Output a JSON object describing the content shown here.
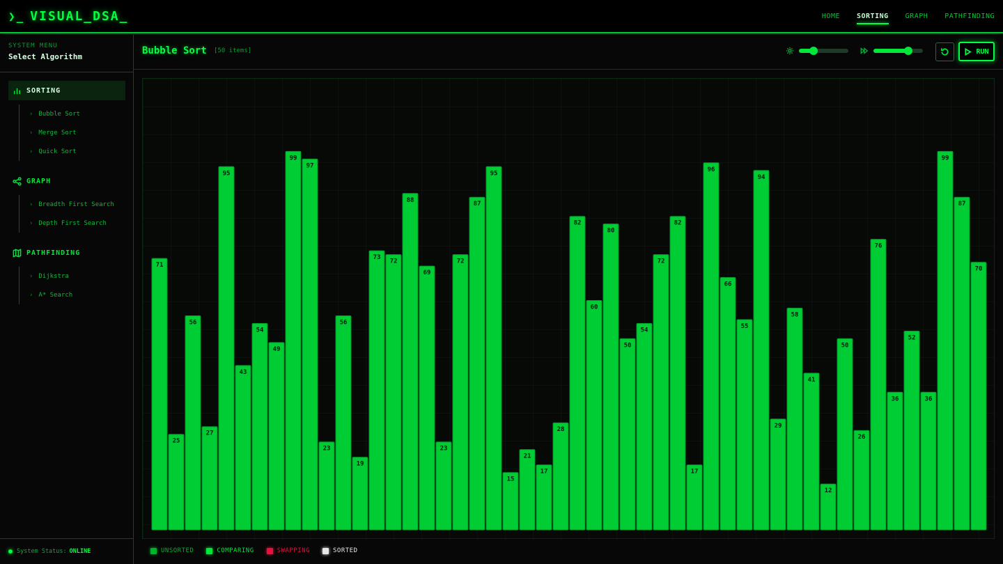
{
  "app": {
    "logo_icon": "terminal-prompt-icon",
    "prompt_glyph": "❯_",
    "title": "VISUAL_DSA_"
  },
  "nav": {
    "items": [
      {
        "label": "HOME",
        "active": false
      },
      {
        "label": "SORTING",
        "active": true
      },
      {
        "label": "GRAPH",
        "active": false
      },
      {
        "label": "PATHFINDING",
        "active": false
      }
    ]
  },
  "sidebar": {
    "subtitle": "SYSTEM MENU",
    "title": "Select Algorithm",
    "groups": [
      {
        "label": "SORTING",
        "icon": "bar-chart-icon",
        "active": true,
        "items": [
          "Bubble Sort",
          "Merge Sort",
          "Quick Sort"
        ]
      },
      {
        "label": "GRAPH",
        "icon": "share-nodes-icon",
        "active": false,
        "items": [
          "Breadth First Search",
          "Depth First Search"
        ]
      },
      {
        "label": "PATHFINDING",
        "icon": "map-icon",
        "active": false,
        "items": [
          "Dijkstra",
          "A* Search"
        ]
      }
    ],
    "status_label": "System Status:",
    "status_value": "ONLINE"
  },
  "toolbar": {
    "algorithm": "Bubble Sort",
    "item_count": "[50 items]",
    "size_icon": "gear-icon",
    "size_level": 0.29,
    "speed_icon": "fast-forward-icon",
    "speed_level": 0.71,
    "reset_icon": "reset-icon",
    "run_icon": "play-icon",
    "run_label": "RUN"
  },
  "chart_data": {
    "type": "bar",
    "values": [
      71,
      25,
      56,
      27,
      95,
      43,
      54,
      49,
      99,
      97,
      23,
      56,
      19,
      73,
      72,
      88,
      69,
      23,
      72,
      87,
      95,
      15,
      21,
      17,
      28,
      82,
      60,
      80,
      50,
      54,
      72,
      82,
      17,
      96,
      66,
      55,
      94,
      29,
      58,
      41,
      12,
      50,
      26,
      76,
      36,
      52,
      36,
      99,
      87,
      70
    ],
    "ylim": [
      0,
      118
    ],
    "grid": true,
    "bar_color": "#00cc33",
    "label_color": "#03200a"
  },
  "legend": [
    {
      "label": "UNSORTED",
      "color": "#00b32d"
    },
    {
      "label": "COMPARING",
      "color": "#00e639"
    },
    {
      "label": "SWAPPING",
      "color": "#e8113c"
    },
    {
      "label": "SORTED",
      "color": "#e8e8e8"
    }
  ],
  "colors": {
    "accent": "#00ff41",
    "bar": "#00cc33",
    "background": "#050505"
  }
}
